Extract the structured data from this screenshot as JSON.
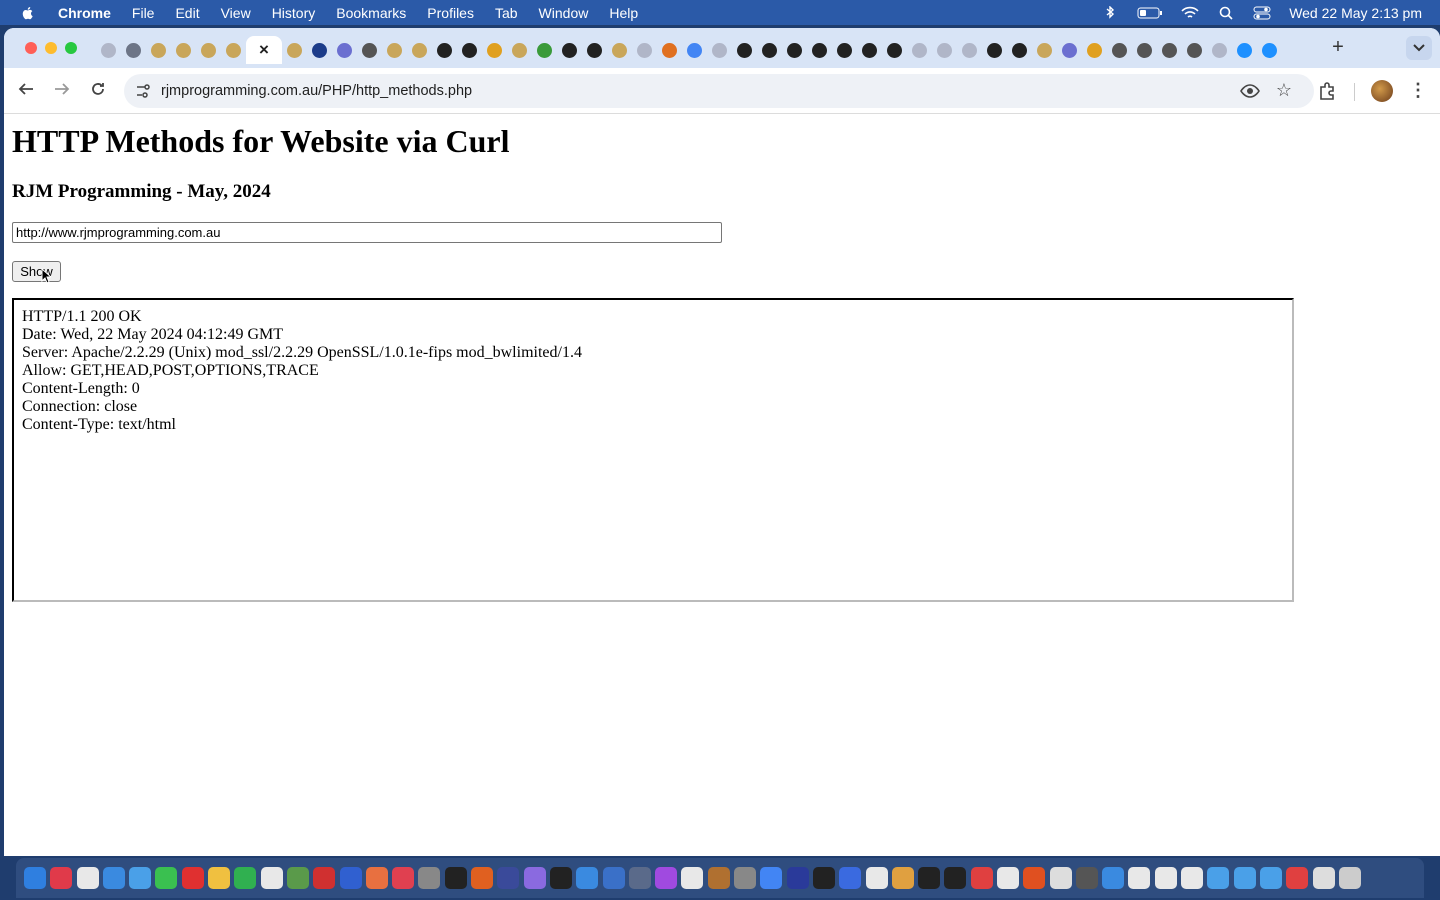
{
  "menubar": {
    "app_name": "Chrome",
    "items": [
      "File",
      "Edit",
      "View",
      "History",
      "Bookmarks",
      "Profiles",
      "Tab",
      "Window",
      "Help"
    ],
    "clock": "Wed 22 May  2:13 pm"
  },
  "browser": {
    "active_tab_close": "×",
    "new_tab": "+",
    "url": "rjmprogramming.com.au/PHP/http_methods.php"
  },
  "page": {
    "title": "HTTP Methods for Website via Curl",
    "subtitle": "RJM Programming - May, 2024",
    "url_input_value": "http://www.rjmprogramming.com.au",
    "show_button_label": "Show",
    "output_lines": [
      "HTTP/1.1 200 OK",
      "Date: Wed, 22 May 2024 04:12:49 GMT",
      "Server: Apache/2.2.29 (Unix) mod_ssl/2.2.29 OpenSSL/1.0.1e-fips mod_bwlimited/1.4",
      "Allow: GET,HEAD,POST,OPTIONS,TRACE",
      "Content-Length: 0",
      "Connection: close",
      "Content-Type: text/html"
    ]
  },
  "colors": {
    "menubar_bg": "#2b5aa8",
    "tabstrip_bg": "#d8e4f6",
    "desktop_bg": "#1f3d6e"
  }
}
